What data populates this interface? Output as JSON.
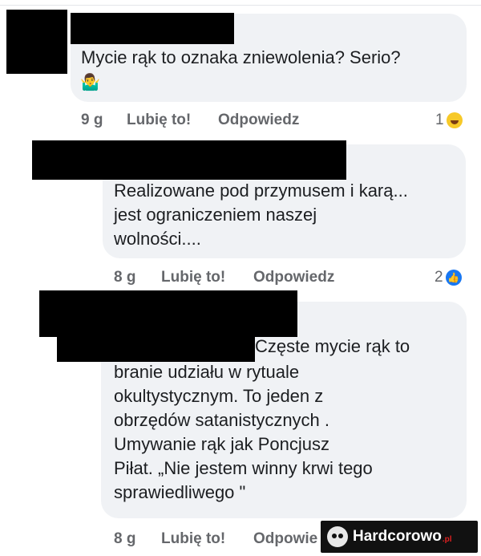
{
  "comments": [
    {
      "text": "Mycie rąk to oznaka zniewolenia? Serio?",
      "emoji": "🤷‍♂️",
      "time": "9 g",
      "like_label": "Lubię to!",
      "reply_label": "Odpowiedz",
      "reaction_count": "1",
      "reaction_icon": "laugh-reaction-icon"
    },
    {
      "text": "Realizowane pod przymusem i karą...\njest ograniczeniem naszej\nwolności....",
      "time": "8 g",
      "like_label": "Lubię to!",
      "reply_label": "Odpowiedz",
      "reaction_count": "2",
      "reaction_icon": "like-reaction-icon"
    },
    {
      "text_first_line": "Częste mycie rąk to",
      "text_rest": "branie udziału w rytuale\nokultystycznym. To jeden z\nobrzędów satanistycznych .\nUmywanie rąk jak Poncjusz\nPiłat. „Nie jestem winny krwi tego\nsprawiedliwego \"",
      "time": "8 g",
      "like_label": "Lubię to!",
      "reply_label": "Odpowie"
    }
  ],
  "watermark": {
    "name": "Hardcorowo",
    "tld": ".pl"
  },
  "colors": {
    "bubble": "#f0f2f5",
    "meta_text": "#65676b",
    "redaction": "#000000",
    "like_blue": "#1877f2"
  }
}
